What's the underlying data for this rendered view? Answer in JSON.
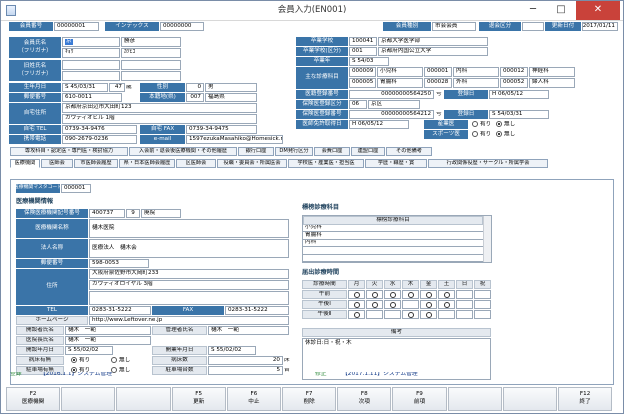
{
  "window": {
    "title": "会員入力(EN001)",
    "min": "─",
    "max": "□",
    "close": "✕"
  },
  "top": {
    "member_no_label": "会員番号",
    "member_no": "00000001",
    "index_label": "インデックス",
    "index": "00000000",
    "member_type_label": "会員種別",
    "member_type": "市会会員",
    "reason_label": "退会区分",
    "reason": "",
    "updated_label": "更新日付",
    "updated": "2017/01/11"
  },
  "person": {
    "name_label1": "会員氏名",
    "name_label2": "（フリガナ）",
    "surname": "京",
    "given": "勝彦",
    "surname_kana": "ｷｮｳ",
    "given_kana": "ｶﾂﾋｺ",
    "old_label1": "旧姓氏名",
    "old_label2": "（フリガナ）",
    "birth_label": "生年月日",
    "birth": "S 45/03/31",
    "age": "47",
    "age_unit": "歳",
    "sex_label": "性別",
    "sex_code": "0",
    "sex": "男",
    "zip_label": "郵便番号",
    "zip": "610-0011",
    "pref_label": "本籍地(県)",
    "pref_code": "007",
    "pref": "福島県",
    "addr_label": "自宅住所",
    "addr1": "京都府京田辺市大田町123",
    "addr2": "ガウディオビル 1階",
    "tel_label": "自宅 TEL",
    "tel": "0739-34-9476",
    "fax_label": "自宅 FAX",
    "fax": "0739-34-9475",
    "mobile_label": "携帯電話",
    "mobile": "090-2679-0236",
    "email_label": "e-mail",
    "email": "1597ezukaMasahiko@Homesick.ne.jp"
  },
  "school": {
    "grad_label": "卒業学校",
    "grad_code": "100041",
    "grad": "京都大学医学部",
    "grad_kind_label": "卒業学校(区分)",
    "grad_kind_code": "001",
    "grad_kind": "京都府内国公立大学",
    "grad_year_label": "卒業年",
    "grad_year": "S 54/03",
    "subj_label": "主な診療科目",
    "subjects": [
      [
        "000009",
        "小児科",
        "000001",
        "内科",
        "000012",
        "神経科"
      ],
      [
        "000005",
        "胃腸科",
        "000028",
        "外科",
        "000052",
        "婦人科"
      ]
    ],
    "reg_label": "医籍登録番号",
    "reg_no": "00000000564250",
    "reg_unit": "号",
    "reg_date_label": "登録日",
    "reg_date": "H 06/05/12",
    "insure_label": "保険医登録区分",
    "insure_code": "06",
    "insure": "京区",
    "insure_no_label": "保険医登録番号",
    "insure_no": "00000000564212",
    "insure_unit": "号",
    "insure_date_label": "登録日",
    "insure_date": "S 54/03/31",
    "approve_label": "医師免許取得日",
    "approve_date": "H 06/05/12",
    "industrial_label": "産業医",
    "industrial_yes": "有り",
    "industrial_no": "無し",
    "sports_label": "スポーツ医",
    "sports_yes": "有り",
    "sports_no": "無し"
  },
  "tabs_row1": [
    "専攻科目・認定医・専門医・検討協力",
    "入会前・退会後医療機関・その他履歴",
    "銀行口座",
    "DM発行区分",
    "会費口座",
    "連盟口座",
    "その他備考"
  ],
  "tabs_row2": [
    "医療機関",
    "医師会",
    "市医師会履歴",
    "県・日本医師会履歴",
    "区医師会",
    "役職・委員会・所属医会",
    "学校医・産業医・担当医",
    "学歴・職歴・賞",
    "行政関係役歴・サークル・所属学会"
  ],
  "inst": {
    "master_label": "医療機関マスタコード",
    "master_code": "000001",
    "section_title": "医療機関情報",
    "insure_code_label": "保険医療機関記号番号",
    "insure_code1": "400737",
    "insure_code2": "9",
    "insure_code3": "廃院",
    "name_label": "医療機関名称",
    "name": "樋木医院",
    "corp_label": "法人名称",
    "corp": "医療法人　樋木会",
    "zip_label": "郵便番号",
    "zip": "598-0053",
    "addr_label": "住所",
    "addr1": "大阪府泉佐野市大岡町233",
    "addr2": "ガウディオロイヤル 3階",
    "tel_label": "TEL",
    "tel": "0283-31-5222",
    "fax_label": "FAX",
    "fax": "0283-31-5222",
    "hp_label": "ホームページ",
    "hp": "http://www.Leftover.ne.jp",
    "founder_label": "開設者氏名",
    "founder": "樋木　一範",
    "manager_label": "管理者氏名",
    "manager": "樋木　一範",
    "director_label": "医院長氏名",
    "director": "樋木　一範",
    "opened_label": "開設年月日",
    "opened": "S 55/02/02",
    "opened2_label": "開業年月日",
    "opened2": "S 55/02/02",
    "ward_label": "病床有無",
    "ward_yes": "有り",
    "ward_no": "無し",
    "beds_label": "病床数",
    "beds": "20",
    "beds_unit": "床",
    "parking_label": "駐車場有無",
    "parking_yes": "有り",
    "parking_no": "無し",
    "park_num_label": "駐車場台数",
    "park_num": "5",
    "park_unit": "台"
  },
  "subjects": {
    "title": "標榜診療科目",
    "header": "標榜診療科目",
    "items": [
      "小児科",
      "胃腸科",
      "内科",
      "",
      ""
    ]
  },
  "hours": {
    "title": "届出診療時間",
    "head_label": "診療時間",
    "days": [
      "月",
      "火",
      "水",
      "木",
      "金",
      "土",
      "日",
      "祝"
    ],
    "rows": [
      {
        "label": "午前",
        "marks": [
          1,
          1,
          1,
          1,
          1,
          1,
          0,
          0
        ]
      },
      {
        "label": "午後Ⅰ",
        "marks": [
          1,
          1,
          1,
          0,
          1,
          1,
          0,
          0
        ]
      },
      {
        "label": "午後Ⅱ",
        "marks": [
          1,
          0,
          0,
          1,
          1,
          0,
          0,
          0
        ]
      }
    ],
    "notes_label": "備考",
    "notes": "休診日:日・祝・木"
  },
  "footer": {
    "reg_label": "登録",
    "reg": "【2016.1.1】システム管理",
    "mod_label": "修正",
    "mod": "【2017.1.11】システム管理"
  },
  "fkeys": [
    {
      "k": "F2",
      "t": "医療機関"
    },
    {
      "k": "",
      "t": ""
    },
    {
      "k": "",
      "t": ""
    },
    {
      "k": "F5",
      "t": "更新"
    },
    {
      "k": "F6",
      "t": "中止"
    },
    {
      "k": "F7",
      "t": "削除"
    },
    {
      "k": "F8",
      "t": "次項"
    },
    {
      "k": "F9",
      "t": "前項"
    },
    {
      "k": "",
      "t": ""
    },
    {
      "k": "",
      "t": ""
    },
    {
      "k": "F12",
      "t": "終了"
    }
  ]
}
